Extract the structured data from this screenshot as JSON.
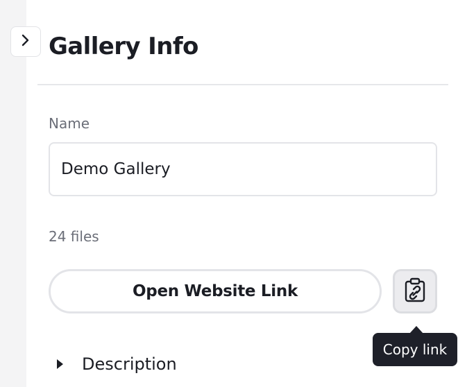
{
  "panel": {
    "title": "Gallery Info",
    "name_label": "Name",
    "name_value": "Demo Gallery",
    "file_count": "24 files",
    "open_link_label": "Open Website Link",
    "copy_tooltip": "Copy link",
    "description_label": "Description"
  },
  "icons": {
    "toggle": "chevron-right-icon",
    "copy": "clipboard-link-icon",
    "description": "caret-right-icon"
  },
  "colors": {
    "text": "#1b1d24",
    "muted_text": "#6b6e78",
    "border": "#e3e4e8",
    "tooltip_bg": "#1e2029",
    "copy_button_bg": "#ececef"
  }
}
